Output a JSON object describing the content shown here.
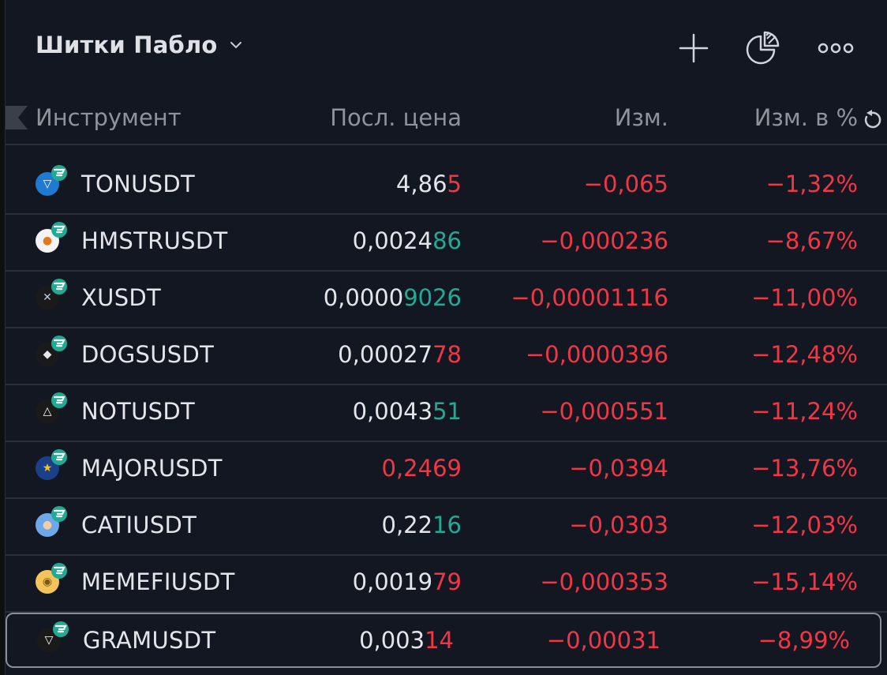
{
  "header": {
    "title": "Шитки Пабло",
    "icons": [
      "chevron-down-icon",
      "plus-icon",
      "pie-chart-icon",
      "more-dots-icon"
    ]
  },
  "columns": {
    "instrument": "Инструмент",
    "last_price": "Посл. цена",
    "change": "Изм.",
    "change_pct": "Изм. в %"
  },
  "colors": {
    "background": "#131722",
    "text": "#e3e5ea",
    "muted": "#8f939c",
    "negative": "#f23645",
    "positive": "#22ab94",
    "divider": "#2a2e39",
    "selected_border": "#8a8e97"
  },
  "rows": [
    {
      "symbol": "TONUSDT",
      "price_base": "4,86",
      "price_tail": "5",
      "tail_color": "red",
      "change": "−0,065",
      "change_pct": "−1,32%",
      "coin_icon": "ton-icon"
    },
    {
      "symbol": "HMSTRUSDT",
      "price_base": "0,0024",
      "price_tail": "86",
      "tail_color": "green",
      "change": "−0,000236",
      "change_pct": "−8,67%",
      "coin_icon": "hamster-icon"
    },
    {
      "symbol": "XUSDT",
      "price_base": "0,0000",
      "price_tail": "9026",
      "tail_color": "green",
      "change": "−0,00001116",
      "change_pct": "−11,00%",
      "coin_icon": "x-empire-icon"
    },
    {
      "symbol": "DOGSUSDT",
      "price_base": "0,00027",
      "price_tail": "78",
      "tail_color": "red",
      "change": "−0,0000396",
      "change_pct": "−12,48%",
      "coin_icon": "dogs-icon"
    },
    {
      "symbol": "NOTUSDT",
      "price_base": "0,0043",
      "price_tail": "51",
      "tail_color": "green",
      "change": "−0,000551",
      "change_pct": "−11,24%",
      "coin_icon": "notcoin-icon"
    },
    {
      "symbol": "MAJORUSDT",
      "price_base": "",
      "price_tail": "0,2469",
      "tail_color": "red",
      "change": "−0,0394",
      "change_pct": "−13,76%",
      "coin_icon": "major-star-icon"
    },
    {
      "symbol": "CATIUSDT",
      "price_base": "0,22",
      "price_tail": "16",
      "tail_color": "green",
      "change": "−0,0303",
      "change_pct": "−12,03%",
      "coin_icon": "catizen-icon"
    },
    {
      "symbol": "MEMEFIUSDT",
      "price_base": "0,0019",
      "price_tail": "79",
      "tail_color": "red",
      "change": "−0,000353",
      "change_pct": "−15,14%",
      "coin_icon": "memefi-icon"
    },
    {
      "symbol": "GRAMUSDT",
      "price_base": "0,003",
      "price_tail": "14",
      "tail_color": "red",
      "change": "−0,00031",
      "change_pct": "−8,99%",
      "coin_icon": "gram-icon",
      "selected": true
    }
  ]
}
